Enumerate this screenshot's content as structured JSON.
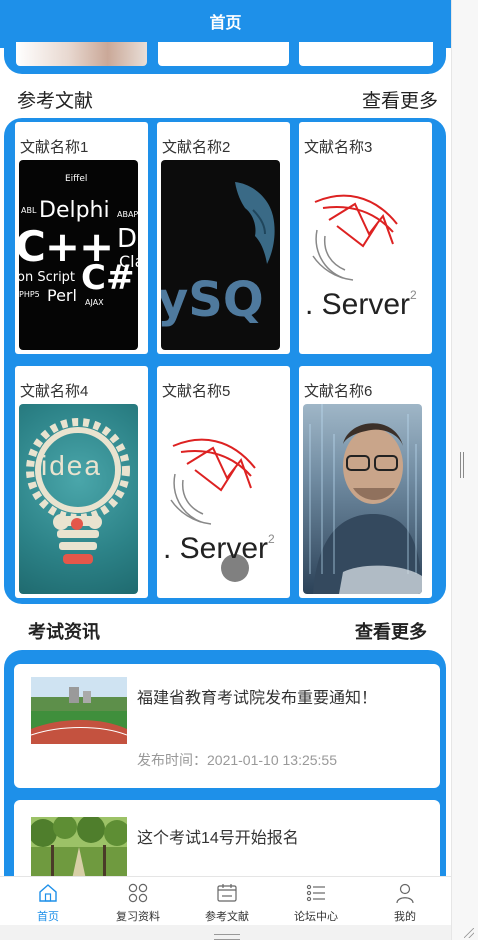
{
  "header": {
    "title": "首页"
  },
  "references": {
    "title": "参考文献",
    "more_label": "查看更多",
    "items": [
      {
        "name": "文献名称1"
      },
      {
        "name": "文献名称2"
      },
      {
        "name": "文献名称3"
      },
      {
        "name": "文献名称4"
      },
      {
        "name": "文献名称5"
      },
      {
        "name": "文献名称6"
      }
    ],
    "image_text": {
      "langs": [
        "Eiffel",
        "ABL",
        "Delphi",
        "ABAP",
        "C++",
        "D",
        "Cla",
        "C#",
        "on Script",
        "Perl",
        "PHP5",
        "AJAX"
      ],
      "mysql": "ySQ",
      "sqlserver": ". Server",
      "sqlserver_sup": "2",
      "idea": "idea"
    }
  },
  "exam": {
    "title": "考试资讯",
    "more_label": "查看更多",
    "items": [
      {
        "headline": "福建省教育考试院发布重要通知！",
        "time": "发布时间：2021-01-10 13:25:55"
      },
      {
        "headline": "这个考试14号开始报名",
        "time": ""
      }
    ]
  },
  "tabbar": {
    "items": [
      {
        "label": "首页",
        "icon": "home-icon",
        "active": true
      },
      {
        "label": "复习资料",
        "icon": "grid-icon",
        "active": false
      },
      {
        "label": "参考文献",
        "icon": "calendar-icon",
        "active": false
      },
      {
        "label": "论坛中心",
        "icon": "list-icon",
        "active": false
      },
      {
        "label": "我的",
        "icon": "user-icon",
        "active": false
      }
    ]
  },
  "colors": {
    "primary": "#1e90e9",
    "text": "#333333",
    "muted": "#999999"
  }
}
